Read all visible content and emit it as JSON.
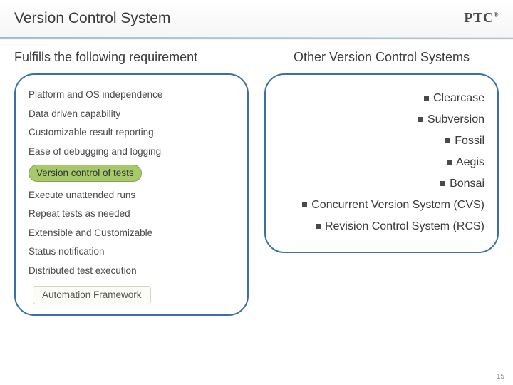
{
  "header": {
    "title": "Version Control System",
    "logo_text": "PTC",
    "logo_mark": "®"
  },
  "left": {
    "title": "Fulfills the following requirement",
    "requirements": {
      "r0": "Platform and OS independence",
      "r1": "Data driven capability",
      "r2": "Customizable result reporting",
      "r3": "Ease of debugging and logging",
      "r4": "Version control of tests",
      "r5": "Execute unattended runs",
      "r6": "Repeat tests as needed",
      "r7": "Extensible and Customizable",
      "r8": "Status notification",
      "r9": "Distributed test execution"
    },
    "framework_label": "Automation Framework"
  },
  "right": {
    "title": "Other Version Control Systems",
    "systems": {
      "s0": "Clearcase",
      "s1": "Subversion",
      "s2": "Fossil",
      "s3": "Aegis",
      "s4": "Bonsai",
      "s5": "Concurrent Version System (CVS)",
      "s6": "Revision Control System (RCS)"
    }
  },
  "footer": {
    "slide_number": "15"
  }
}
